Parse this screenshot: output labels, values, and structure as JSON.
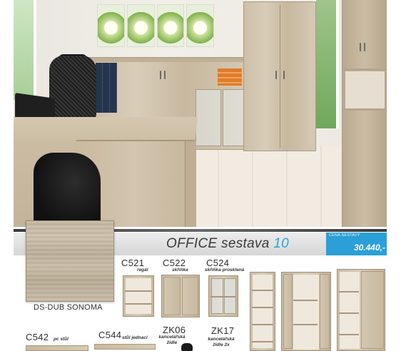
{
  "set": {
    "title_text": "OFFICE sestava ",
    "title_number": "10",
    "price_caption": "CENA SESTAVY",
    "price": "30.440,-"
  },
  "finish": {
    "label": "DS-DUB SONOMA"
  },
  "products": [
    {
      "code": "C521",
      "desc": "regál"
    },
    {
      "code": "C522",
      "desc": "skříňka"
    },
    {
      "code": "C524",
      "desc": "skříňka prosklená"
    },
    {
      "code": "C542",
      "desc": "pc stůl"
    },
    {
      "code": "C544",
      "desc": "stůl jednací"
    },
    {
      "code": "ZK06",
      "desc": "kancelářská židle"
    },
    {
      "code": "ZK17",
      "desc": "kancelářská židle 2x"
    }
  ],
  "colors": {
    "accent_blue": "#2a9fd8",
    "band_grey": "#dcdcdc",
    "oak": "#cdbfa8"
  }
}
